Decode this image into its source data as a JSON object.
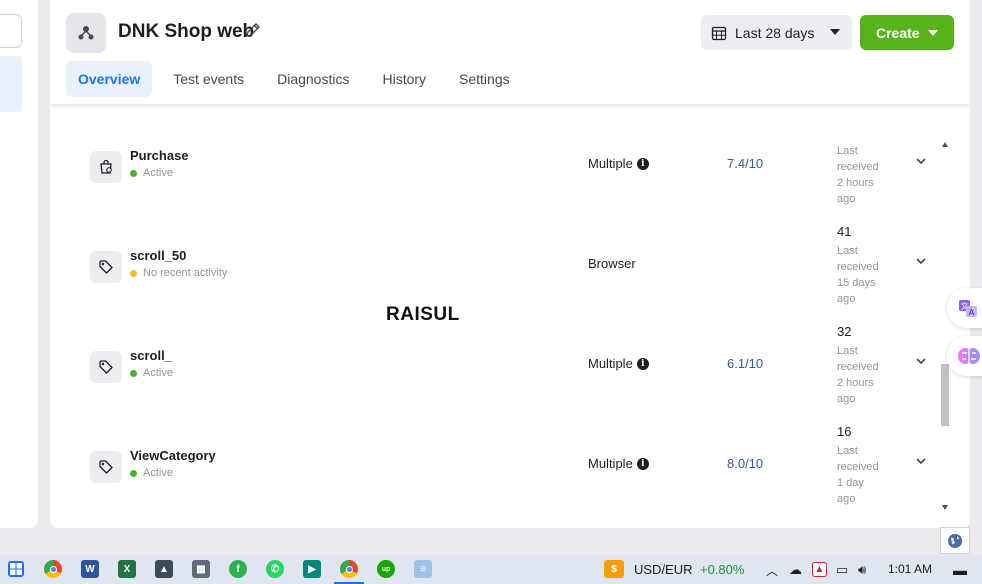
{
  "header": {
    "title": "DNK Shop web",
    "date_range": "Last 28 days",
    "create_label": "Create"
  },
  "tabs": [
    {
      "label": "Overview",
      "active": true
    },
    {
      "label": "Test events",
      "active": false
    },
    {
      "label": "Diagnostics",
      "active": false
    },
    {
      "label": "History",
      "active": false
    },
    {
      "label": "Settings",
      "active": false
    }
  ],
  "events": [
    {
      "name": "Purchase",
      "status": "Active",
      "status_color": "#42b72a",
      "integration": "Multiple",
      "info": true,
      "score": "7.4/10",
      "count": "",
      "last_lines": [
        "Last",
        "received",
        "2 hours",
        "ago"
      ]
    },
    {
      "name": "scroll_50",
      "status": "No recent activity",
      "status_color": "#f7b928",
      "integration": "Browser",
      "info": false,
      "score": "",
      "count": "41",
      "last_lines": [
        "Last",
        "received",
        "15 days",
        "ago"
      ]
    },
    {
      "name": "scroll_",
      "status": "Active",
      "status_color": "#42b72a",
      "integration": "Multiple",
      "info": true,
      "score": "6.1/10",
      "count": "32",
      "last_lines": [
        "Last",
        "received",
        "2 hours",
        "ago"
      ]
    },
    {
      "name": "ViewCategory",
      "status": "Active",
      "status_color": "#42b72a",
      "integration": "Multiple",
      "info": true,
      "score": "8.0/10",
      "count": "16",
      "last_lines": [
        "Last",
        "received",
        "1 day",
        "ago"
      ]
    }
  ],
  "watermark": "RAISUL",
  "taskbar": {
    "currency_pair": "USD/EUR",
    "currency_change": "+0.80%",
    "currency_change_color": "#1e8e3e",
    "time": "1:01 AM",
    "apps": [
      "windows-icon",
      "chrome-icon",
      "word-icon",
      "excel-icon",
      "photos-icon",
      "calculator-icon",
      "feedly-icon",
      "whatsapp-icon",
      "meet-icon",
      "chrome-icon",
      "upwork-icon",
      "notepad-icon"
    ]
  },
  "colors": {
    "accent": "#1877f2",
    "create_green": "#58b21b",
    "score_blue": "#385898"
  }
}
